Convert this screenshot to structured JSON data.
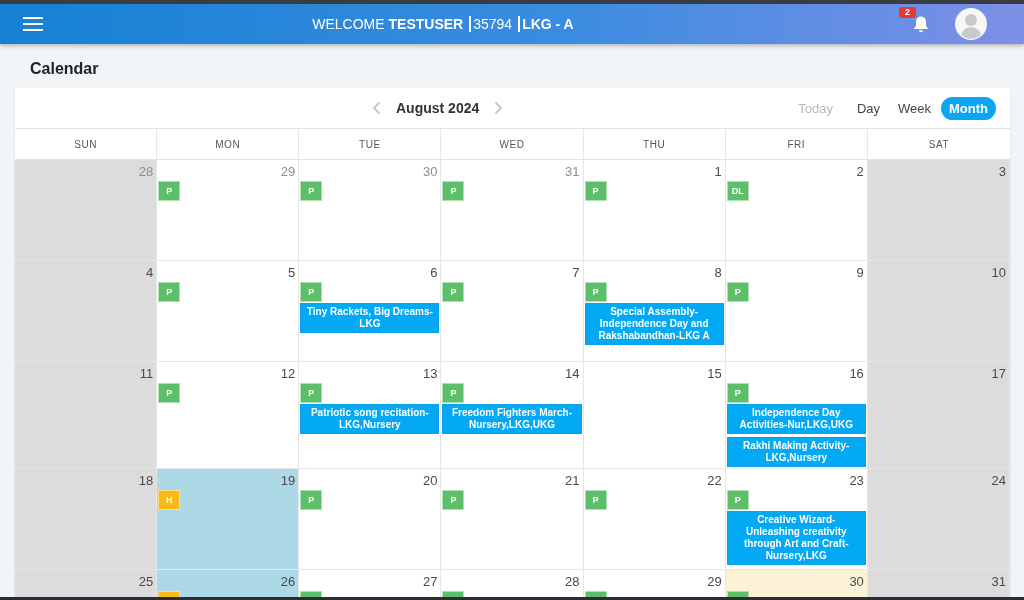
{
  "header": {
    "greeting": "WELCOME **TESTUSER**",
    "user_id": "35794",
    "class_name": "LKG - A",
    "notification_count": "2"
  },
  "page_title": "Calendar",
  "toolbar": {
    "title": "August 2024",
    "today": {
      "label": "Today",
      "disabled": true
    },
    "views": [
      {
        "label": "Day",
        "selected": false
      },
      {
        "label": "Week",
        "selected": false
      },
      {
        "label": "Month",
        "selected": true
      }
    ]
  },
  "weekdays": [
    "SUN",
    "MON",
    "TUE",
    "WED",
    "THU",
    "FRI",
    "SAT"
  ],
  "weeks": [
    {
      "days": [
        {
          "date": "28",
          "kind": "weekend",
          "other_month": true
        },
        {
          "date": "29",
          "kind": "weekday",
          "other_month": true,
          "tags": [
            {
              "label": "P",
              "color": "#5ebf6a"
            }
          ]
        },
        {
          "date": "30",
          "kind": "weekday",
          "other_month": true,
          "tags": [
            {
              "label": "P",
              "color": "#5ebf6a"
            }
          ]
        },
        {
          "date": "31",
          "kind": "weekday",
          "other_month": true,
          "tags": [
            {
              "label": "P",
              "color": "#5ebf6a"
            }
          ]
        },
        {
          "date": "1",
          "kind": "weekday",
          "other_month": false,
          "tags": [
            {
              "label": "P",
              "color": "#5ebf6a"
            }
          ]
        },
        {
          "date": "2",
          "kind": "weekday",
          "other_month": false,
          "tags": [
            {
              "label": "DL",
              "color": "#5ebf6a"
            }
          ]
        },
        {
          "date": "3",
          "kind": "weekend",
          "other_month": false
        }
      ]
    },
    {
      "days": [
        {
          "date": "4",
          "kind": "weekend",
          "other_month": false
        },
        {
          "date": "5",
          "kind": "weekday",
          "other_month": false,
          "tags": [
            {
              "label": "P",
              "color": "#5ebf6a"
            }
          ]
        },
        {
          "date": "6",
          "kind": "weekday",
          "other_month": false,
          "tags": [
            {
              "label": "P",
              "color": "#5ebf6a"
            }
          ],
          "events": [
            "Tiny Rackets, Big Dreams-LKG"
          ]
        },
        {
          "date": "7",
          "kind": "weekday",
          "other_month": false,
          "tags": [
            {
              "label": "P",
              "color": "#5ebf6a"
            }
          ]
        },
        {
          "date": "8",
          "kind": "weekday",
          "other_month": false,
          "tags": [
            {
              "label": "P",
              "color": "#5ebf6a"
            }
          ],
          "events": [
            "Special Assembly-Independence Day and Rakshabandhan-LKG A"
          ]
        },
        {
          "date": "9",
          "kind": "weekday",
          "other_month": false,
          "tags": [
            {
              "label": "P",
              "color": "#5ebf6a"
            }
          ]
        },
        {
          "date": "10",
          "kind": "weekend",
          "other_month": false
        }
      ]
    },
    {
      "days": [
        {
          "date": "11",
          "kind": "weekend",
          "other_month": false
        },
        {
          "date": "12",
          "kind": "weekday",
          "other_month": false,
          "tags": [
            {
              "label": "P",
              "color": "#5ebf6a"
            }
          ]
        },
        {
          "date": "13",
          "kind": "weekday",
          "other_month": false,
          "tags": [
            {
              "label": "P",
              "color": "#5ebf6a"
            }
          ],
          "events": [
            "Patriotic song recitation-LKG,Nursery"
          ]
        },
        {
          "date": "14",
          "kind": "weekday",
          "other_month": false,
          "tags": [
            {
              "label": "P",
              "color": "#5ebf6a"
            }
          ],
          "events": [
            "Freedom Fighters March-Nursery,LKG,UKG"
          ]
        },
        {
          "date": "15",
          "kind": "weekday",
          "other_month": false
        },
        {
          "date": "16",
          "kind": "weekday",
          "other_month": false,
          "tags": [
            {
              "label": "P",
              "color": "#5ebf6a"
            }
          ],
          "events": [
            "Independence Day Activities-Nur,LKG,UKG",
            "Rakhi Making Activity-LKG,Nursery"
          ]
        },
        {
          "date": "17",
          "kind": "weekend",
          "other_month": false
        }
      ]
    },
    {
      "days": [
        {
          "date": "18",
          "kind": "weekend",
          "other_month": false
        },
        {
          "date": "19",
          "kind": "holiday",
          "other_month": false,
          "tags": [
            {
              "label": "H",
              "color": "#fbb917"
            }
          ]
        },
        {
          "date": "20",
          "kind": "weekday",
          "other_month": false,
          "tags": [
            {
              "label": "P",
              "color": "#5ebf6a"
            }
          ]
        },
        {
          "date": "21",
          "kind": "weekday",
          "other_month": false,
          "tags": [
            {
              "label": "P",
              "color": "#5ebf6a"
            }
          ]
        },
        {
          "date": "22",
          "kind": "weekday",
          "other_month": false,
          "tags": [
            {
              "label": "P",
              "color": "#5ebf6a"
            }
          ]
        },
        {
          "date": "23",
          "kind": "weekday",
          "other_month": false,
          "tags": [
            {
              "label": "P",
              "color": "#5ebf6a"
            }
          ],
          "events": [
            "Creative Wizard-Unleashing creativity through Art and Craft-Nursery,LKG"
          ]
        },
        {
          "date": "24",
          "kind": "weekend",
          "other_month": false
        }
      ]
    },
    {
      "days": [
        {
          "date": "25",
          "kind": "weekend",
          "other_month": false
        },
        {
          "date": "26",
          "kind": "holiday",
          "other_month": false,
          "tags": [
            {
              "color": "#fbb917"
            }
          ]
        },
        {
          "date": "27",
          "kind": "weekday",
          "other_month": false,
          "tags": [
            {
              "color": "#5ebf6a"
            }
          ]
        },
        {
          "date": "28",
          "kind": "weekday",
          "other_month": false,
          "tags": [
            {
              "color": "#5ebf6a"
            }
          ]
        },
        {
          "date": "29",
          "kind": "weekday",
          "other_month": false,
          "tags": [
            {
              "color": "#5ebf6a"
            }
          ]
        },
        {
          "date": "30",
          "kind": "today",
          "other_month": false,
          "tags": [
            {
              "color": "#5ebf6a"
            }
          ]
        },
        {
          "date": "31",
          "kind": "weekend",
          "other_month": false
        }
      ]
    }
  ]
}
